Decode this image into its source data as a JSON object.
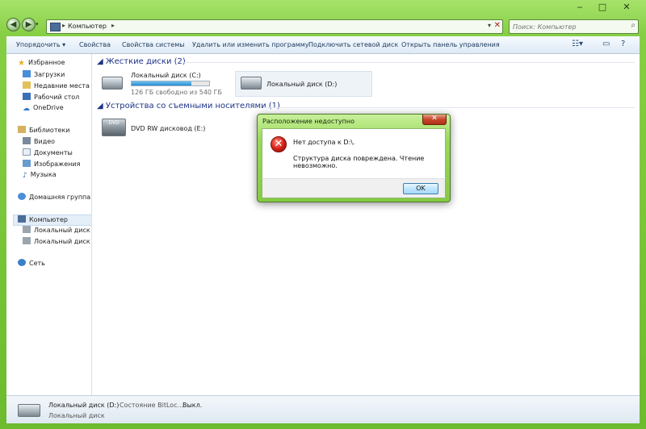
{
  "address": {
    "location": "Компьютер",
    "search_placeholder": "Поиск: Компьютер"
  },
  "toolbar": {
    "items": [
      "Упорядочить",
      "Свойства",
      "Свойства системы",
      "Удалить или изменить программу",
      "Подключить сетевой диск",
      "Открыть панель управления"
    ]
  },
  "navpane": {
    "favorites": "Избранное",
    "fav_items": [
      "Загрузки",
      "Недавние места",
      "Рабочий стол",
      "OneDrive"
    ],
    "libraries": "Библиотеки",
    "lib_items": [
      "Видео",
      "Документы",
      "Изображения",
      "Музыка"
    ],
    "homegroup": "Домашняя группа",
    "computer": "Компьютер",
    "comp_items": [
      "Локальный диск (C",
      "Локальный диск (D"
    ],
    "network": "Сеть"
  },
  "main": {
    "hdd_group": "Жесткие диски (2)",
    "removable_group": "Устройства со съемными носителями (1)",
    "drive_c": {
      "name": "Локальный диск (C:)",
      "free": "126 ГБ свободно из 540 ГБ",
      "used_fraction": 0.77
    },
    "drive_d": {
      "name": "Локальный диск (D:)"
    },
    "drive_e": {
      "name": "DVD RW дисковод (E:)"
    }
  },
  "status": {
    "name": "Локальный диск (D:)",
    "bitlocker": "Состояние BitLoc...",
    "state": "Выкл.",
    "type": "Локальный диск"
  },
  "dialog": {
    "title": "Расположение недоступно",
    "line1": "Нет доступа к D:\\.",
    "line2": "Структура диска повреждена. Чтение невозможно.",
    "ok": "OK",
    "close": "✕"
  },
  "colors": {
    "accent": "#86c945",
    "link": "#1e3287",
    "error": "#d21e14"
  }
}
